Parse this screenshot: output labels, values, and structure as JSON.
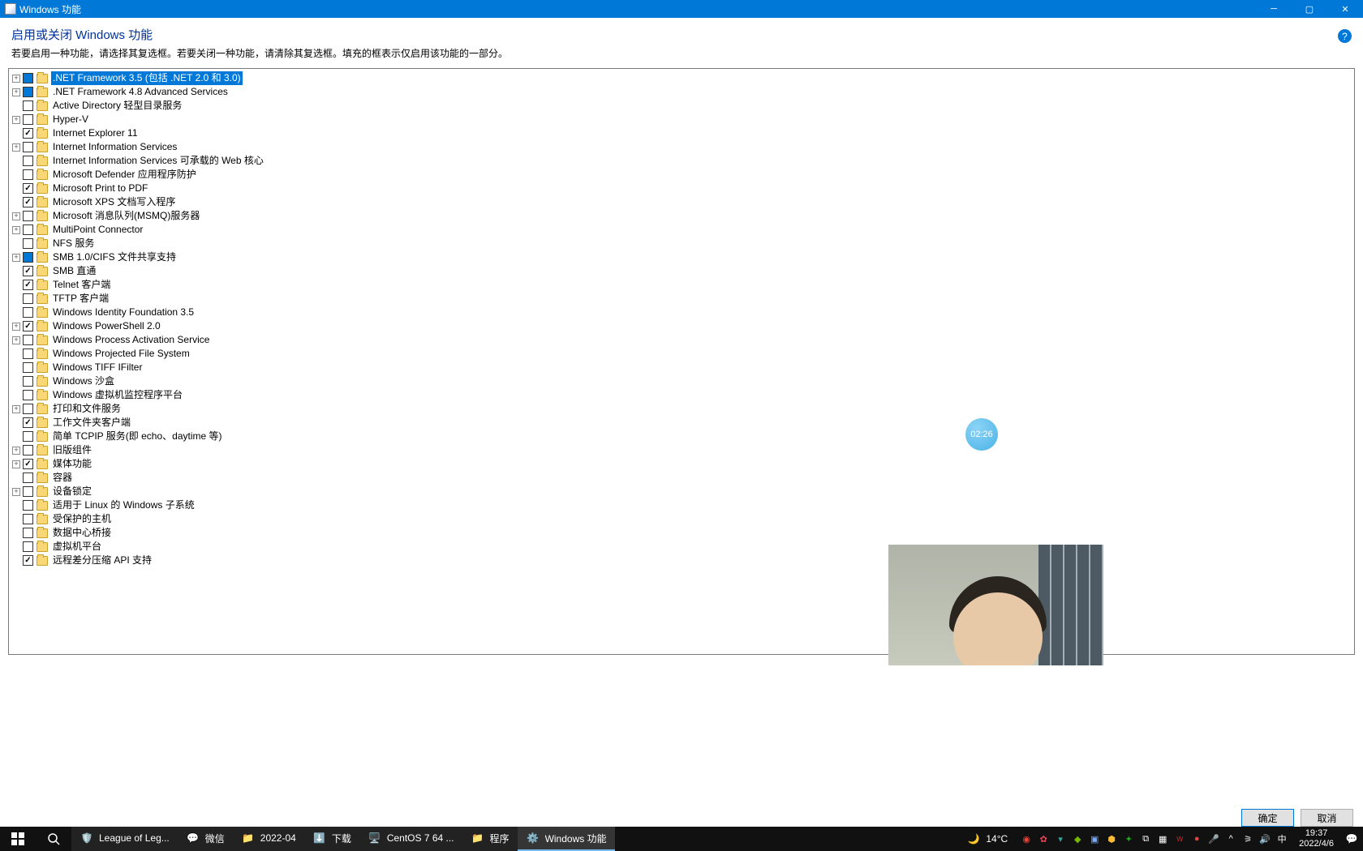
{
  "window": {
    "title": "Windows 功能",
    "page_title": "启用或关闭 Windows 功能",
    "description": "若要启用一种功能，请选择其复选框。若要关闭一种功能，请清除其复选框。填充的框表示仅启用该功能的一部分。"
  },
  "tree": [
    {
      "expand": "+",
      "state": "partial",
      "label": ".NET Framework 3.5 (包括 .NET 2.0 和 3.0)",
      "selected": true
    },
    {
      "expand": "+",
      "state": "partial",
      "label": ".NET Framework 4.8 Advanced Services"
    },
    {
      "expand": " ",
      "state": "unchecked",
      "label": "Active Directory 轻型目录服务"
    },
    {
      "expand": "+",
      "state": "unchecked",
      "label": "Hyper-V"
    },
    {
      "expand": " ",
      "state": "checked",
      "label": "Internet Explorer 11"
    },
    {
      "expand": "+",
      "state": "unchecked",
      "label": "Internet Information Services"
    },
    {
      "expand": " ",
      "state": "unchecked",
      "label": "Internet Information Services 可承载的 Web 核心"
    },
    {
      "expand": " ",
      "state": "unchecked",
      "label": "Microsoft Defender 应用程序防护"
    },
    {
      "expand": " ",
      "state": "checked",
      "label": "Microsoft Print to PDF"
    },
    {
      "expand": " ",
      "state": "checked",
      "label": "Microsoft XPS 文档写入程序"
    },
    {
      "expand": "+",
      "state": "unchecked",
      "label": "Microsoft 消息队列(MSMQ)服务器"
    },
    {
      "expand": "+",
      "state": "unchecked",
      "label": "MultiPoint Connector"
    },
    {
      "expand": " ",
      "state": "unchecked",
      "label": "NFS 服务"
    },
    {
      "expand": "+",
      "state": "partial",
      "label": "SMB 1.0/CIFS 文件共享支持"
    },
    {
      "expand": " ",
      "state": "checked",
      "label": "SMB 直通"
    },
    {
      "expand": " ",
      "state": "checked",
      "label": "Telnet 客户端"
    },
    {
      "expand": " ",
      "state": "unchecked",
      "label": "TFTP 客户端"
    },
    {
      "expand": " ",
      "state": "unchecked",
      "label": "Windows Identity Foundation 3.5"
    },
    {
      "expand": "+",
      "state": "checked",
      "label": "Windows PowerShell 2.0"
    },
    {
      "expand": "+",
      "state": "unchecked",
      "label": "Windows Process Activation Service"
    },
    {
      "expand": " ",
      "state": "unchecked",
      "label": "Windows Projected File System"
    },
    {
      "expand": " ",
      "state": "unchecked",
      "label": "Windows TIFF IFilter"
    },
    {
      "expand": " ",
      "state": "unchecked",
      "label": "Windows 沙盒"
    },
    {
      "expand": " ",
      "state": "unchecked",
      "label": "Windows 虚拟机监控程序平台"
    },
    {
      "expand": "+",
      "state": "unchecked",
      "label": "打印和文件服务"
    },
    {
      "expand": " ",
      "state": "checked",
      "label": "工作文件夹客户端"
    },
    {
      "expand": " ",
      "state": "unchecked",
      "label": "简单 TCPIP 服务(即 echo、daytime 等)"
    },
    {
      "expand": "+",
      "state": "unchecked",
      "label": "旧版组件"
    },
    {
      "expand": "+",
      "state": "checked",
      "label": "媒体功能"
    },
    {
      "expand": " ",
      "state": "unchecked",
      "label": "容器"
    },
    {
      "expand": "+",
      "state": "unchecked",
      "label": "设备锁定"
    },
    {
      "expand": " ",
      "state": "unchecked",
      "label": "适用于 Linux 的 Windows 子系统"
    },
    {
      "expand": " ",
      "state": "unchecked",
      "label": "受保护的主机"
    },
    {
      "expand": " ",
      "state": "unchecked",
      "label": "数据中心桥接"
    },
    {
      "expand": " ",
      "state": "unchecked",
      "label": "虚拟机平台"
    },
    {
      "expand": " ",
      "state": "checked",
      "label": "远程差分压缩 API 支持"
    }
  ],
  "buttons": {
    "ok": "确定",
    "cancel": "取消"
  },
  "timer": "02:26",
  "taskbar": {
    "weather_temp": "14°C",
    "items": [
      {
        "label": "League of Leg..."
      },
      {
        "label": "微信"
      },
      {
        "label": "2022-04"
      },
      {
        "label": "下载"
      },
      {
        "label": "CentOS 7 64 ..."
      },
      {
        "label": "程序"
      },
      {
        "label": "Windows 功能",
        "active": true
      }
    ],
    "ime": "中",
    "time": "19:37",
    "date": "2022/4/6"
  }
}
